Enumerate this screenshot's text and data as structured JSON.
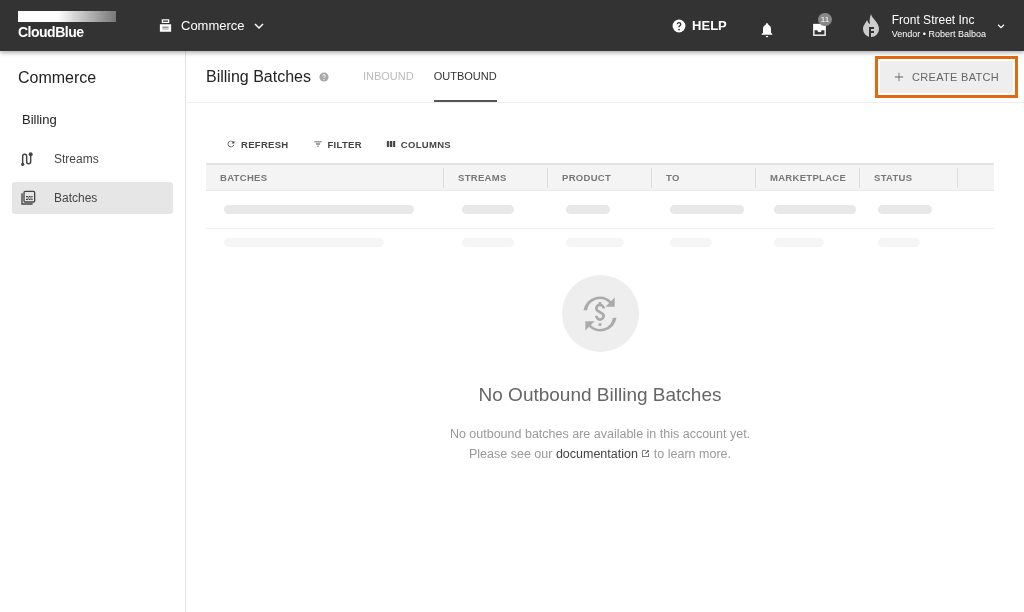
{
  "header": {
    "logo": "CloudBlue",
    "module": "Commerce",
    "help": "HELP",
    "notification_count": "11",
    "account": {
      "name": "Front Street Inc",
      "role": "Vendor • Robert Balboa"
    }
  },
  "sidebar": {
    "title": "Commerce",
    "section": "Billing",
    "items": [
      {
        "label": "Streams",
        "kind": "streams",
        "selected": false
      },
      {
        "label": "Batches",
        "kind": "batches",
        "selected": true
      }
    ]
  },
  "page": {
    "title": "Billing Batches",
    "tabs": [
      {
        "label": "INBOUND",
        "selected": false
      },
      {
        "label": "OUTBOUND",
        "selected": true
      }
    ],
    "create_button": {
      "label": "CREATE BATCH",
      "highlighted": true
    }
  },
  "toolbar": [
    {
      "label": "REFRESH",
      "kind": "refresh"
    },
    {
      "label": "FILTER",
      "kind": "filter"
    },
    {
      "label": "COLUMNS",
      "kind": "columns"
    }
  ],
  "table": {
    "columns": [
      "BATCHES",
      "STREAMS",
      "PRODUCT",
      "TO",
      "MARKETPLACE",
      "STATUS"
    ]
  },
  "empty_state": {
    "title": "No Outbound Billing Batches",
    "line_1": "No outbound batches are available in this account yet.",
    "line_2_before": "Please see our",
    "link": "documentation",
    "line_2_after": "to learn more."
  }
}
